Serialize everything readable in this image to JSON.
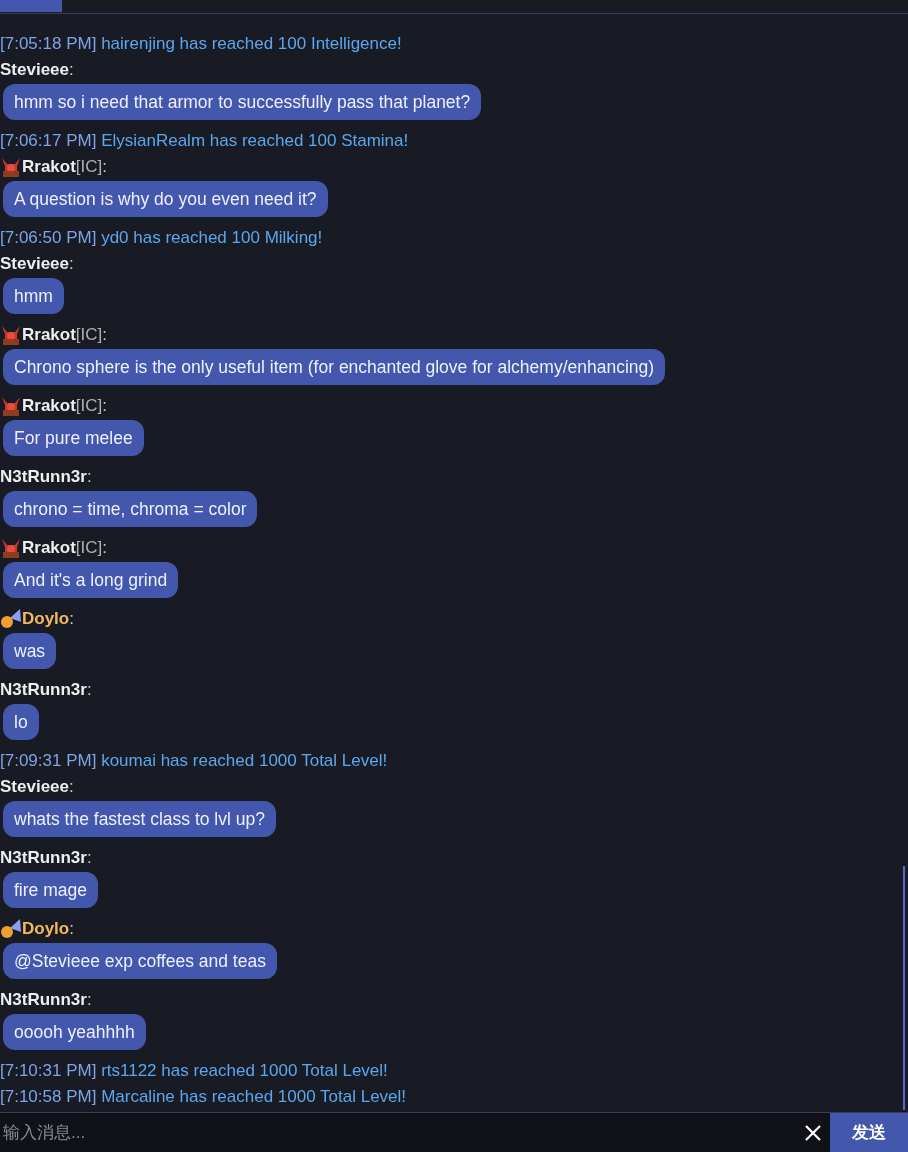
{
  "messages": [
    {
      "kind": "system",
      "time": "[7:05:18 PM]",
      "text": "hairenjing has reached 100 Intelligence!"
    },
    {
      "kind": "chat",
      "name": "Stevieee",
      "separator": ":",
      "highlight": false,
      "text": "hmm so i need that armor to successfully pass that planet?"
    },
    {
      "kind": "system",
      "time": "[7:06:17 PM]",
      "text": "ElysianRealm has reached 100 Stamina!"
    },
    {
      "kind": "chat",
      "name": "Rrakot",
      "avatar": {
        "kind": "demon"
      },
      "tag": "[IC]",
      "separator": ":",
      "highlight": false,
      "text": "A question is why do you even need it?"
    },
    {
      "kind": "system",
      "time": "[7:06:50 PM]",
      "text": "yd0 has reached 100 Milking!"
    },
    {
      "kind": "chat",
      "name": "Stevieee",
      "separator": ":",
      "highlight": false,
      "text": "hmm"
    },
    {
      "kind": "chat",
      "name": "Rrakot",
      "avatar": {
        "kind": "demon"
      },
      "tag": "[IC]",
      "separator": ":",
      "highlight": false,
      "text": "Chrono sphere is the only useful item (for enchanted glove for alchemy/enhancing)"
    },
    {
      "kind": "chat",
      "name": "Rrakot",
      "avatar": {
        "kind": "demon"
      },
      "tag": "[IC]",
      "separator": ":",
      "highlight": false,
      "text": "For pure melee"
    },
    {
      "kind": "chat",
      "name": "N3tRunn3r",
      "separator": ":",
      "highlight": false,
      "text": "chrono = time, chroma = color"
    },
    {
      "kind": "chat",
      "name": "Rrakot",
      "avatar": {
        "kind": "demon"
      },
      "tag": "[IC]",
      "separator": ":",
      "highlight": false,
      "text": "And it's a long grind"
    },
    {
      "kind": "chat",
      "name": "Doylo",
      "avatar": {
        "kind": "fairy"
      },
      "separator": ":",
      "highlight": true,
      "text": "was"
    },
    {
      "kind": "chat",
      "name": "N3tRunn3r",
      "separator": ":",
      "highlight": false,
      "text": "lo"
    },
    {
      "kind": "system",
      "time": "[7:09:31 PM]",
      "text": "koumai has reached 1000 Total Level!"
    },
    {
      "kind": "chat",
      "name": "Stevieee",
      "separator": ":",
      "highlight": false,
      "text": "whats the fastest class to lvl up?"
    },
    {
      "kind": "chat",
      "name": "N3tRunn3r",
      "separator": ":",
      "highlight": false,
      "text": "fire mage"
    },
    {
      "kind": "chat",
      "name": "Doylo",
      "avatar": {
        "kind": "fairy"
      },
      "separator": ":",
      "highlight": true,
      "text": "@Stevieee exp coffees and teas"
    },
    {
      "kind": "chat",
      "name": "N3tRunn3r",
      "separator": ":",
      "highlight": false,
      "text": "ooooh yeahhhh"
    },
    {
      "kind": "system",
      "time": "[7:10:31 PM]",
      "text": "rts1122 has reached 1000 Total Level!"
    },
    {
      "kind": "system",
      "time": "[7:10:58 PM]",
      "text": "Marcaline has reached 1000 Total Level!"
    }
  ],
  "input": {
    "placeholder": "输入消息..."
  },
  "send_button": "发送"
}
